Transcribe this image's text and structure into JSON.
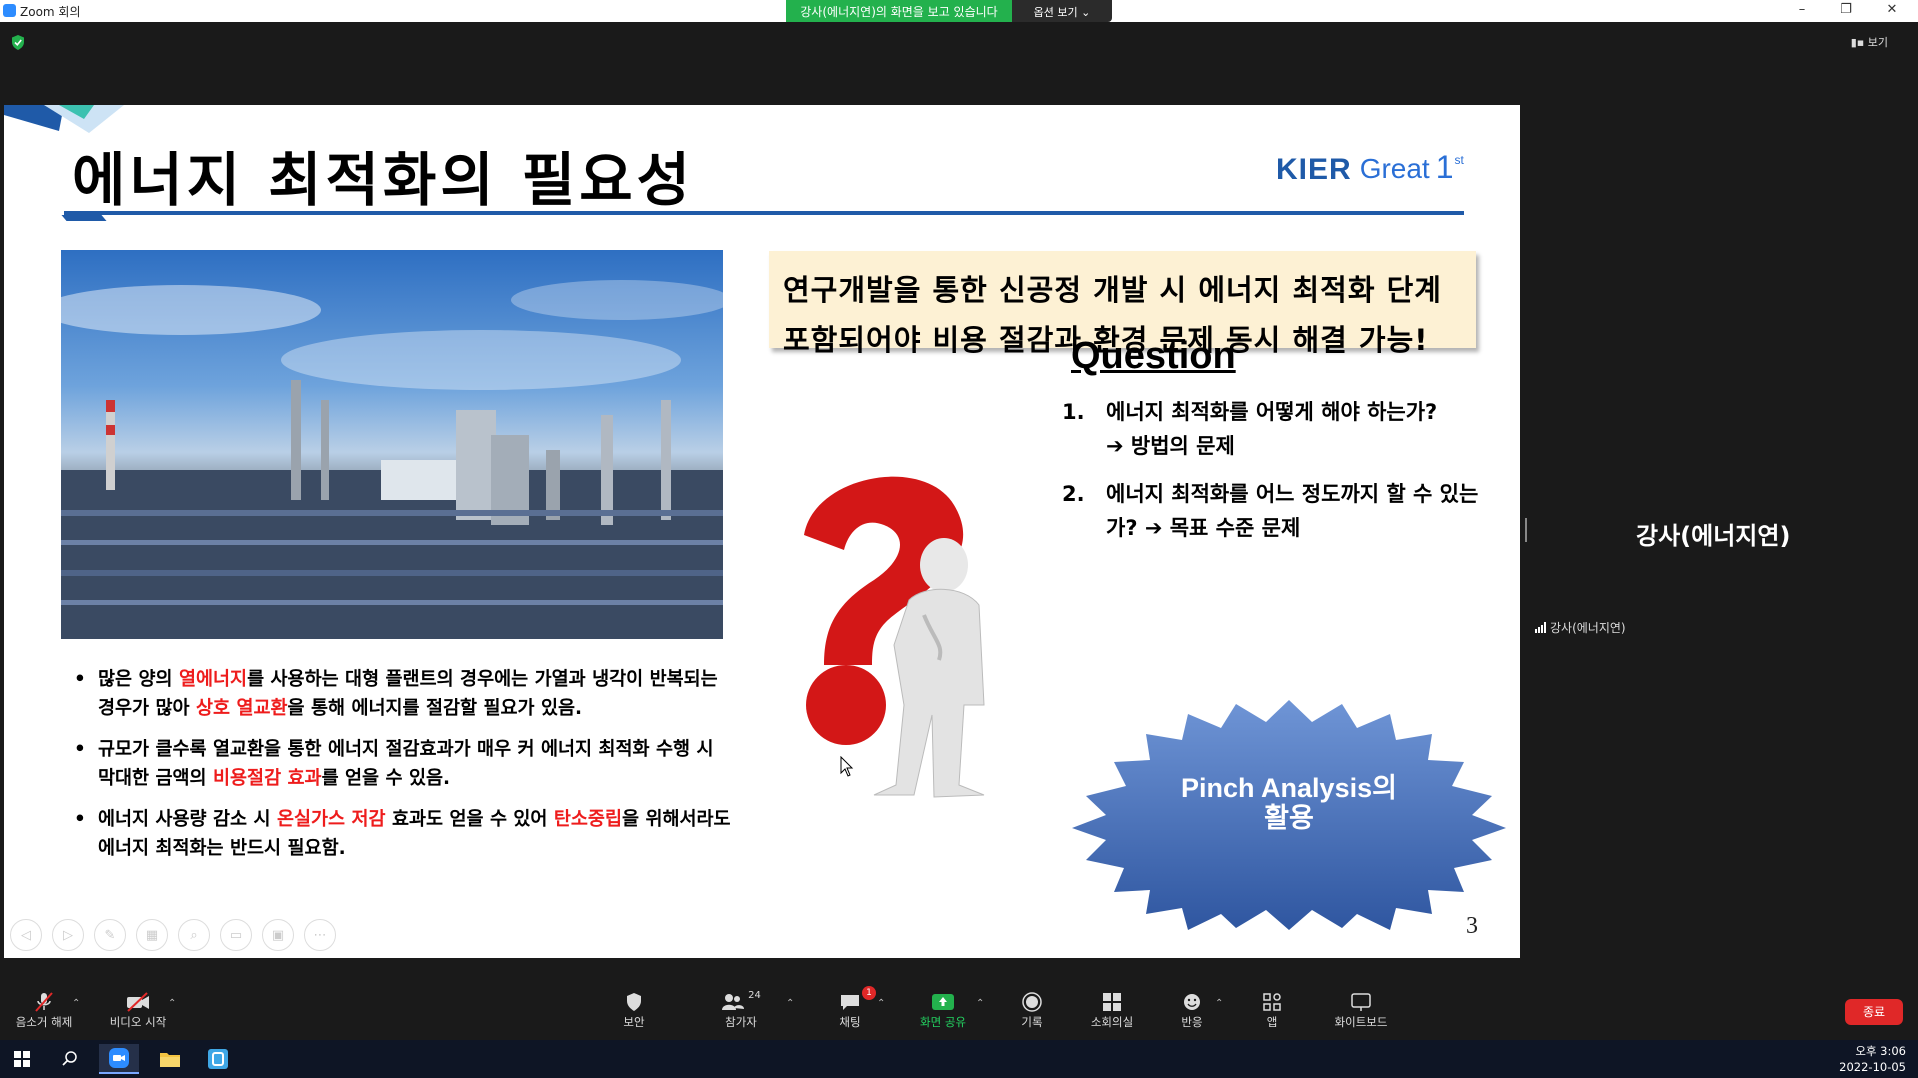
{
  "window": {
    "title": "Zoom 회의",
    "minimize": "–",
    "maximize": "❐",
    "close": "✕"
  },
  "share_banner": {
    "message": "강사(에너지연)의 화면을 보고 있습니다",
    "options": "옵션 보기 ⌄"
  },
  "top": {
    "view_label": "보기"
  },
  "slide": {
    "title": "에너지 최적화의 필요성",
    "logo": {
      "kier": "KIER",
      "great": "Great",
      "one": "1",
      "st": "st"
    },
    "callout": [
      "연구개발을 통한 신공정 개발 시 에너지 최적화 단계",
      "포함되어야 비용 절감과 환경 문제 동시 해결 가능!"
    ],
    "question_title": "Question",
    "questions": [
      {
        "num": "1.",
        "text": "에너지 최적화를 어떻게 해야 하는가?",
        "sub": "➔ 방법의 문제"
      },
      {
        "num": "2.",
        "text": "에너지 최적화를 어느 정도까지 할 수 있는가?",
        "sub": "➔ 목표 수준 문제"
      }
    ],
    "bullets": [
      {
        "dot": "•",
        "parts": [
          "많은 양의 ",
          "열에너지",
          "를 사용하는 대형 플랜트의 경우에는 가열과 냉각이 반복되는 경우가 많아 ",
          "상호 열교환",
          "을 통해 에너지를 절감할 필요가 있음."
        ]
      },
      {
        "dot": "•",
        "parts": [
          "규모가 클수록 열교환을 통한 에너지 절감효과가 매우 커 에너지 최적화 수행 시 막대한 금액의 ",
          "비용절감 효과",
          "를 얻을 수 있음."
        ]
      },
      {
        "dot": "•",
        "parts": [
          "에너지 사용량 감소 시 ",
          "온실가스 저감",
          " 효과도 얻을 수 있어 ",
          "탄소중립",
          "을 위해서라도 에너지 최적화는 반드시 필요함."
        ]
      }
    ],
    "burst": {
      "line1": "Pinch Analysis의",
      "line2": "활용"
    },
    "page_number": "3"
  },
  "speaker": {
    "name_large": "강사(에너지연)",
    "name_label": "강사(에너지연)"
  },
  "toolbar": {
    "unmute": "음소거 해제",
    "video": "비디오 시작",
    "security": "보안",
    "participants": "참가자",
    "participants_count": "24",
    "chat": "채팅",
    "chat_badge": "1",
    "share": "화면 공유",
    "record": "기록",
    "breakout": "소회의실",
    "reactions": "반응",
    "apps": "앱",
    "whiteboard": "화이트보드",
    "end": "종료"
  },
  "taskbar": {
    "time": "오후 3:06",
    "date": "2022-10-05"
  }
}
